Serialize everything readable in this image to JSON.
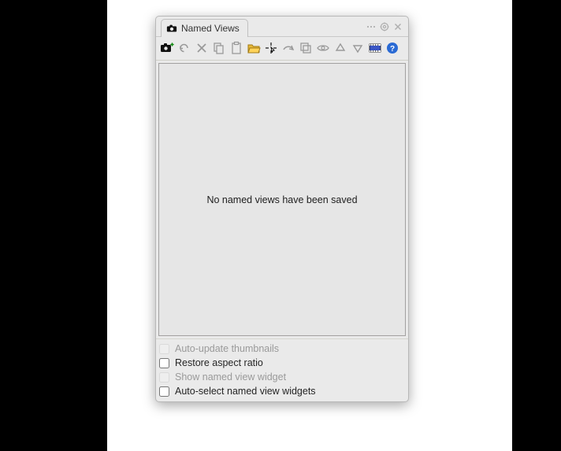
{
  "title": "Named Views",
  "empty_message": "No named views have been saved",
  "options": {
    "auto_update_thumbnails": {
      "label": "Auto-update thumbnails",
      "checked": false,
      "enabled": false
    },
    "restore_aspect_ratio": {
      "label": "Restore aspect ratio",
      "checked": false,
      "enabled": true
    },
    "show_widget": {
      "label": "Show named view widget",
      "checked": false,
      "enabled": false
    },
    "auto_select_widgets": {
      "label": "Auto-select named view widgets",
      "checked": false,
      "enabled": true
    }
  },
  "colors": {
    "panel_bg": "#eaeaea",
    "content_bg": "#e6e6e6",
    "border": "#b8b8b8"
  }
}
